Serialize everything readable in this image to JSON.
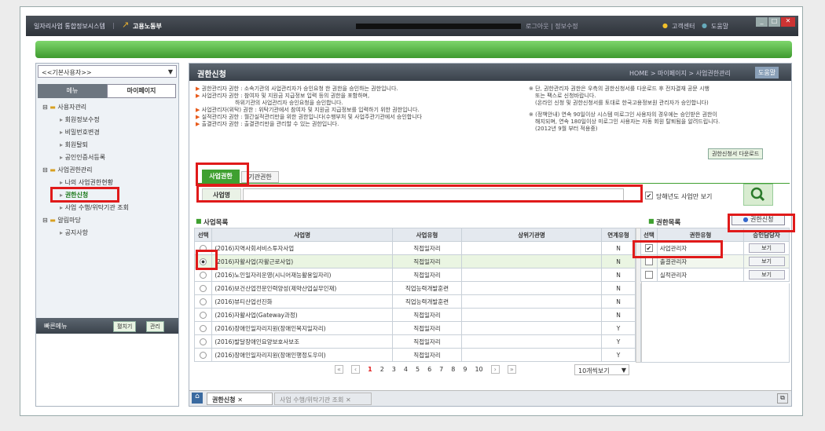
{
  "window": {
    "app_title": "일자리사업 통합정보시스템",
    "brand": "고용노동부",
    "top_links": "로그아웃 | 정보수정",
    "customer_center": "고객센터",
    "help": "도움말",
    "win_controls": [
      "_",
      "□",
      "✕"
    ]
  },
  "left": {
    "user_select": "<<기본사용자>>",
    "tabs": [
      "메뉴",
      "마이페이지"
    ],
    "tree": [
      {
        "label": "사용자관리",
        "type": "folder"
      },
      {
        "label": "회원정보수정",
        "type": "leaf"
      },
      {
        "label": "비밀번호변경",
        "type": "leaf"
      },
      {
        "label": "회원탈퇴",
        "type": "leaf"
      },
      {
        "label": "공인인증서등록",
        "type": "leaf"
      },
      {
        "label": "사업권한관리",
        "type": "folder"
      },
      {
        "label": "나의 사업권한현황",
        "type": "leaf"
      },
      {
        "label": "권한신청",
        "type": "leaf-active"
      },
      {
        "label": "사업 수행/위탁기관 조회",
        "type": "leaf"
      },
      {
        "label": "알림마당",
        "type": "folder"
      },
      {
        "label": "공지사항",
        "type": "leaf"
      }
    ],
    "quick_menu": "빠른메뉴",
    "quick_buttons": [
      "펼치기",
      "관리"
    ]
  },
  "main": {
    "title": "권한신청",
    "breadcrumb": "HOME > 마이페이지 > 사업권한관리",
    "help_button": "도움말",
    "notes_left": [
      "권한관리자 권한 : 소속기관의 사업관리자가 승인요청 한 권한을 승인하는 권한입니다.",
      "사업관리자 권한 : 참여자 및 지원금 지급정보 입력 등의 권한을 포함하며,",
      "하위기관의 사업관리자 승인요청을 승인합니다.",
      "사업관리자(위탁) 권한 : 위탁기관에서 참여자 및 지원금 지급정보를 입력하기 위한 권한입니다.",
      "실적관리자 권한 : 월간실적관리만을 위한 권한입니다(수행부처 및 사업주관기관에서 승인합니다",
      "출결관리자 권한 : 출결관리만을 관리할 수 있는 권한입니다."
    ],
    "notes_right": [
      "※ 단, 권한관리자 권한은 우측의 권한신청서를 다운로드 후 전자결재 공문 시행",
      "또는 팩스로 신청바랍니다.",
      "(온라인 신청 및 권한신청서를 토대로 한국고용정보원 관리자가 승인합니다)",
      "※ (정책안내) 연속 90일이상 시스템 미로그인 사용자의 경우에는 승인받은 권한이",
      "해지되며, 연속 180일이상 미로그인 사용자는 자동 회원 탈퇴됨을 알려드립니다.",
      "(2012년 9월 부터 적용중)"
    ],
    "download_button": "권한신청서 다운로드",
    "tabs": [
      "사업권한",
      "기관권한"
    ],
    "search_label": "사업명",
    "search_value": "",
    "this_year_only": "당해년도 사업만 보기",
    "program_list_title": "사업목록",
    "program_headers": [
      "선택",
      "사업명",
      "사업유형",
      "상위기관명",
      "연계유형"
    ],
    "programs": [
      {
        "name": "(2016)지역사회서비스투자사업",
        "type": "직접일자리",
        "parent": "",
        "link": "N",
        "selected": false
      },
      {
        "name": "(2016)자활사업(자활근로사업)",
        "type": "직접일자리",
        "parent": "",
        "link": "N",
        "selected": true
      },
      {
        "name": "(2016)노인일자리운영(시니어재능활용일자리)",
        "type": "직접일자리",
        "parent": "",
        "link": "N",
        "selected": false
      },
      {
        "name": "(2016)보건산업전문인력양성(제약산업실무인재)",
        "type": "직업능력개발훈련",
        "parent": "",
        "link": "N",
        "selected": false
      },
      {
        "name": "(2016)뷰티산업선진화",
        "type": "직업능력개발훈련",
        "parent": "",
        "link": "N",
        "selected": false
      },
      {
        "name": "(2016)자활사업(Gateway과정)",
        "type": "직접일자리",
        "parent": "",
        "link": "N",
        "selected": false
      },
      {
        "name": "(2016)장애인일자리지원(장애인복지일자리)",
        "type": "직접일자리",
        "parent": "",
        "link": "Y",
        "selected": false
      },
      {
        "name": "(2016)발달장애인요양보호사보조",
        "type": "직접일자리",
        "parent": "",
        "link": "Y",
        "selected": false
      },
      {
        "name": "(2016)장애인일자리지원(장애인행정도우미)",
        "type": "직접일자리",
        "parent": "",
        "link": "Y",
        "selected": false
      }
    ],
    "pagination": {
      "pages": [
        "1",
        "2",
        "3",
        "4",
        "5",
        "6",
        "7",
        "8",
        "9",
        "10"
      ],
      "current": "1",
      "per_page": "10개씩보기"
    },
    "auth_list_title": "권한목록",
    "apply_button": "권한신청",
    "auth_headers": [
      "선택",
      "권한유형",
      "승인담당자"
    ],
    "auths": [
      {
        "type": "사업관리자",
        "checked": true,
        "view": "보기"
      },
      {
        "type": "출결관리자",
        "checked": false,
        "view": "보기"
      },
      {
        "type": "실적관리자",
        "checked": false,
        "view": "보기"
      }
    ],
    "bottom_tabs": [
      "권한신청",
      "사업 수행/위탁기관 조회"
    ]
  },
  "colors": {
    "accent_red": "#e01a1a",
    "green": "#4caf3a",
    "header": "#3a424b"
  }
}
